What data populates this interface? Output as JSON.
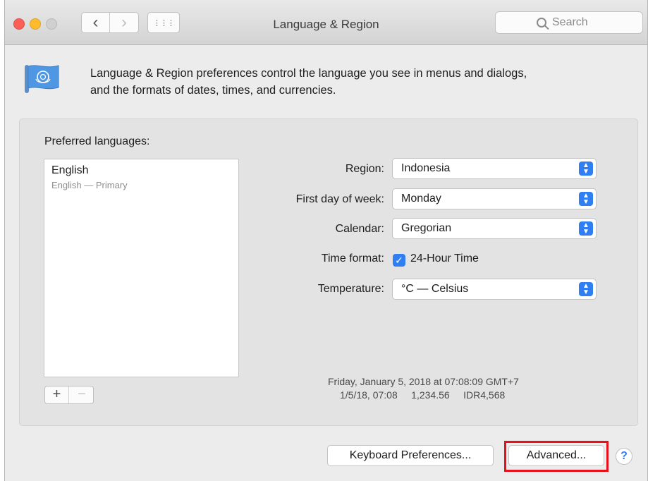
{
  "window": {
    "title": "Language & Region",
    "search_placeholder": "Search",
    "nav_back": "‹",
    "nav_forward": "›",
    "grid": "⋮⋮⋮"
  },
  "intro": {
    "line1": "Language & Region preferences control the language you see in menus and dialogs,",
    "line2": "and the formats of dates, times, and currencies."
  },
  "languages": {
    "label": "Preferred languages:",
    "items": [
      {
        "name": "English",
        "detail": "English — Primary"
      }
    ],
    "add": "+",
    "remove": "−"
  },
  "settings": {
    "region_label": "Region:",
    "region_value": "Indonesia",
    "first_day_label": "First day of week:",
    "first_day_value": "Monday",
    "calendar_label": "Calendar:",
    "calendar_value": "Gregorian",
    "time_format_label": "Time format:",
    "time_format_option": "24-Hour Time",
    "time_format_checked": true,
    "temperature_label": "Temperature:",
    "temperature_value": "°C — Celsius"
  },
  "sample": {
    "line1": "Friday, January 5, 2018 at 07:08:09 GMT+7",
    "line2": "1/5/18, 07:08     1,234.56     IDR4,568"
  },
  "footer": {
    "keyboard_button": "Keyboard Preferences...",
    "advanced_button": "Advanced...",
    "help": "?"
  },
  "colors": {
    "accent": "#2f7ff3",
    "highlight": "#e8101b"
  }
}
